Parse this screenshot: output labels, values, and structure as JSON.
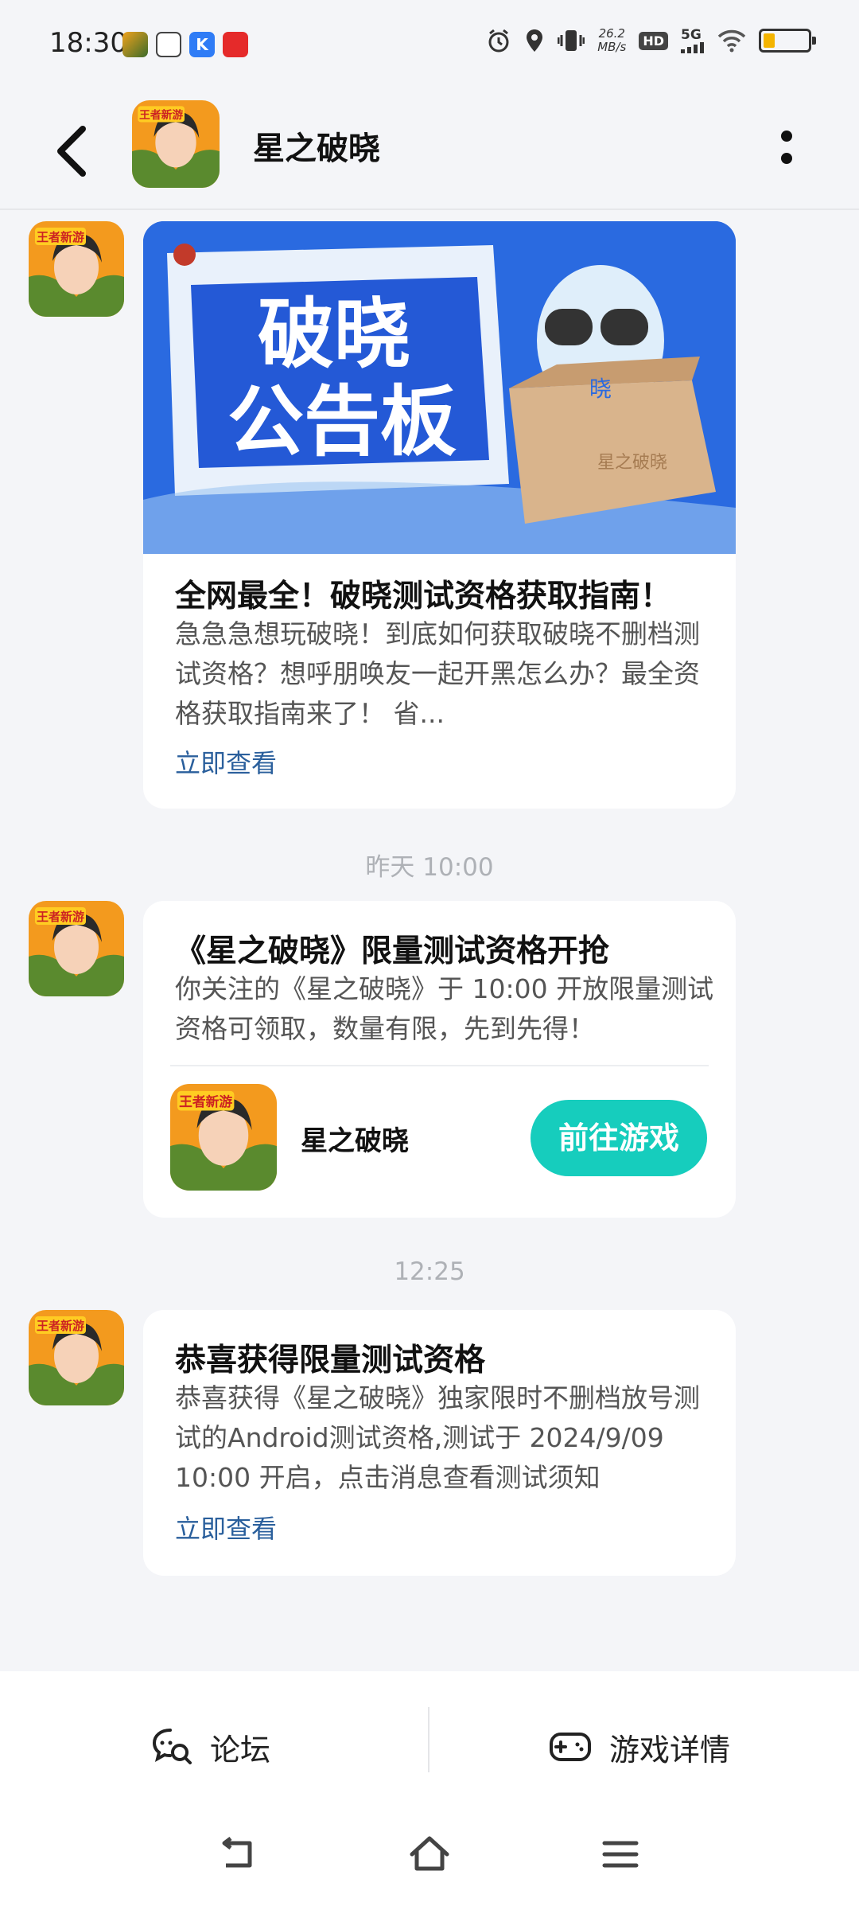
{
  "status_bar": {
    "time": "18:30",
    "net_speed_value": "26.2",
    "net_speed_unit": "MB/s",
    "hd_label": "HD",
    "network_label": "5G",
    "battery_level": 0.2
  },
  "header": {
    "title": "星之破晓",
    "avatar_text": "王者新游"
  },
  "banner": {
    "line1": "破晓",
    "line2": "公告板",
    "box_mark": "晓",
    "box_logo": "星之破晓"
  },
  "messages": [
    {
      "title": "全网最全！破晓测试资格获取指南！",
      "body": "急急急想玩破晓！到底如何获取破晓不删档测试资格？想呼朋唤友一起开黑怎么办？最全资格获取指南来了！ 省...",
      "link": "立即查看"
    },
    {
      "timestamp": "昨天 10:00",
      "title": "《星之破晓》限量测试资格开抢",
      "body": "你关注的《星之破晓》于 10:00 开放限量测试资格可领取，数量有限，先到先得！",
      "game_name": "星之破晓",
      "button": "前往游戏"
    },
    {
      "timestamp": "12:25",
      "title": "恭喜获得限量测试资格",
      "body": "恭喜获得《星之破晓》独家限时不删档放号测试的Android测试资格,测试于 2024/9/09 10:00 开启，点击消息查看测试须知",
      "link": "立即查看"
    }
  ],
  "bottom_bar": {
    "forum": "论坛",
    "game_details": "游戏详情"
  },
  "colors": {
    "accent": "#16cdbd",
    "link": "#2a5f9c",
    "banner_blue": "#1f5fd6"
  }
}
